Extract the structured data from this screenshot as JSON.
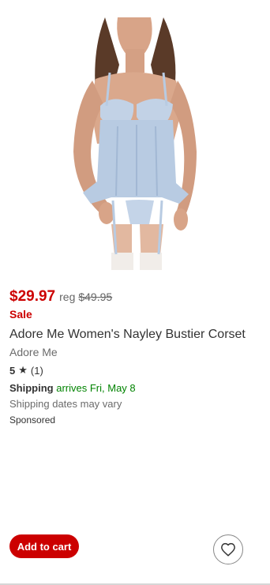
{
  "product": {
    "price": "$29.97",
    "reg_label": "reg",
    "reg_price": "$49.95",
    "sale_label": "Sale",
    "title": "Adore Me Women's Nayley Bustier Corset",
    "brand": "Adore Me",
    "rating": "5",
    "rating_icon": "star-icon",
    "review_count": "(1)",
    "shipping_label": "Shipping",
    "shipping_date": "arrives Fri, May 8",
    "shipping_note": "Shipping dates may vary",
    "sponsored": "Sponsored"
  },
  "actions": {
    "add_to_cart": "Add to cart",
    "favorite_icon": "heart-icon"
  },
  "colors": {
    "price_red": "#cc0000",
    "shipping_green": "#008300",
    "button_red": "#cc0000"
  }
}
